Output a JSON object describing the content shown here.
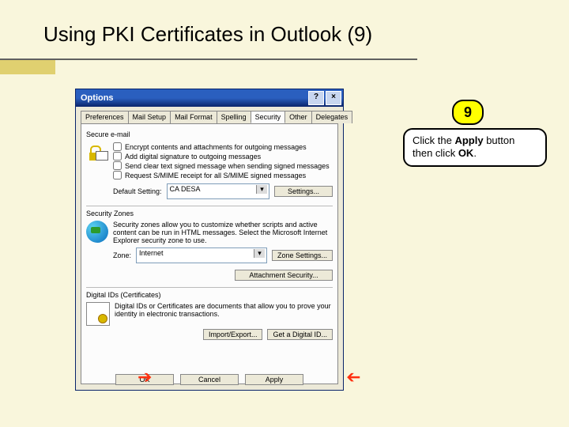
{
  "slide": {
    "title": "Using PKI Certificates in Outlook (9)"
  },
  "callout": {
    "number": "9",
    "line1": "Click the ",
    "bold1": "Apply",
    "line2": " button then click ",
    "bold2": "OK",
    "line3": "."
  },
  "window": {
    "title": "Options",
    "help": "?",
    "close": "×",
    "tabs": {
      "preferences": "Preferences",
      "mail_setup": "Mail Setup",
      "mail_format": "Mail Format",
      "spelling": "Spelling",
      "security": "Security",
      "other": "Other",
      "delegates": "Delegates"
    },
    "secure_email": {
      "title": "Secure e-mail",
      "encrypt": "Encrypt contents and attachments for outgoing messages",
      "sign": "Add digital signature to outgoing messages",
      "cleartext": "Send clear text signed message when sending signed messages",
      "receipt": "Request S/MIME receipt for all S/MIME signed messages",
      "default_label": "Default Setting:",
      "default_value": "CA DESA",
      "settings_btn": "Settings..."
    },
    "zones": {
      "title": "Security Zones",
      "desc": "Security zones allow you to customize whether scripts and active content can be run in HTML messages. Select the Microsoft Internet Explorer security zone to use.",
      "zone_label": "Zone:",
      "zone_value": "Internet",
      "zone_btn": "Zone Settings...",
      "attach_btn": "Attachment Security..."
    },
    "digital_ids": {
      "title": "Digital IDs (Certificates)",
      "desc": "Digital IDs or Certificates are documents that allow you to prove your identity in electronic transactions.",
      "import_btn": "Import/Export...",
      "get_btn": "Get a Digital ID..."
    },
    "buttons": {
      "ok": "OK",
      "cancel": "Cancel",
      "apply": "Apply"
    }
  }
}
